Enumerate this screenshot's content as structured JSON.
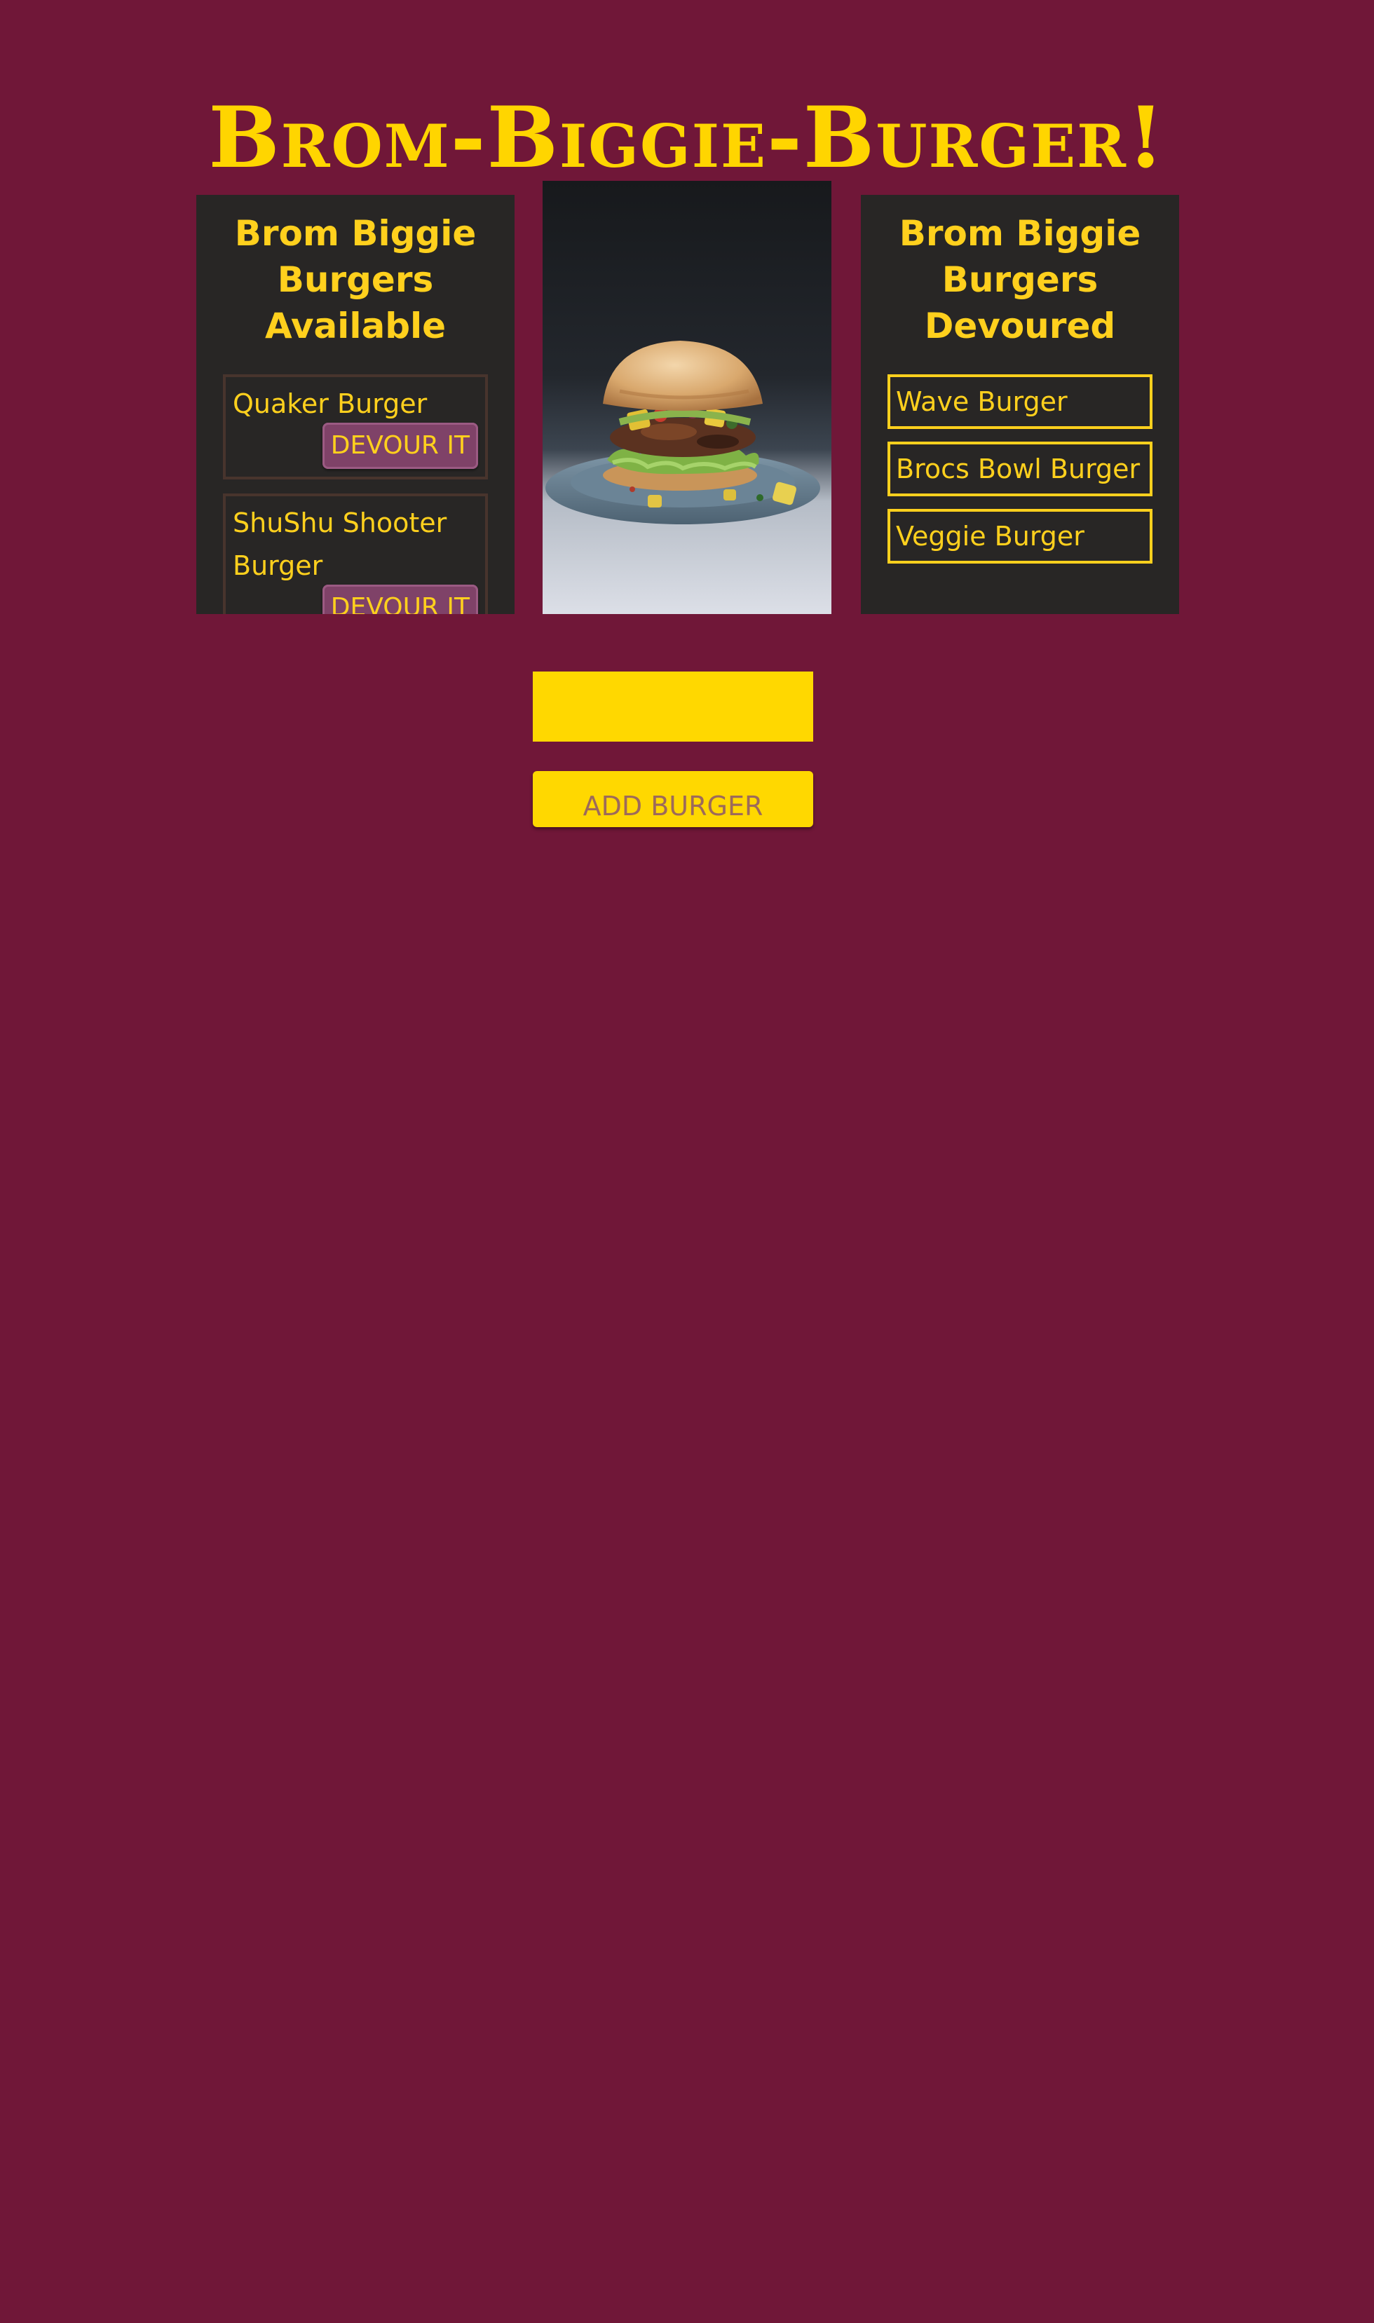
{
  "header": {
    "title": "Brom-Biggie-Burger!"
  },
  "available": {
    "heading": "Brom Biggie Burgers Available",
    "items": [
      {
        "name": "Quaker Burger",
        "button_label": "DEVOUR IT"
      },
      {
        "name": "ShuShu Shooter Burger",
        "button_label": "DEVOUR IT"
      }
    ]
  },
  "devoured": {
    "heading": "Brom Biggie Burgers Devoured",
    "items": [
      {
        "name": "Wave Burger"
      },
      {
        "name": "Brocs Bowl Burger"
      },
      {
        "name": "Veggie Burger"
      }
    ]
  },
  "form": {
    "input_value": "",
    "add_button_label": "ADD BURGER"
  },
  "colors": {
    "background": "#701738",
    "accent": "#ffd01d",
    "panel": "#282625",
    "devour_button": "#7f4268"
  }
}
